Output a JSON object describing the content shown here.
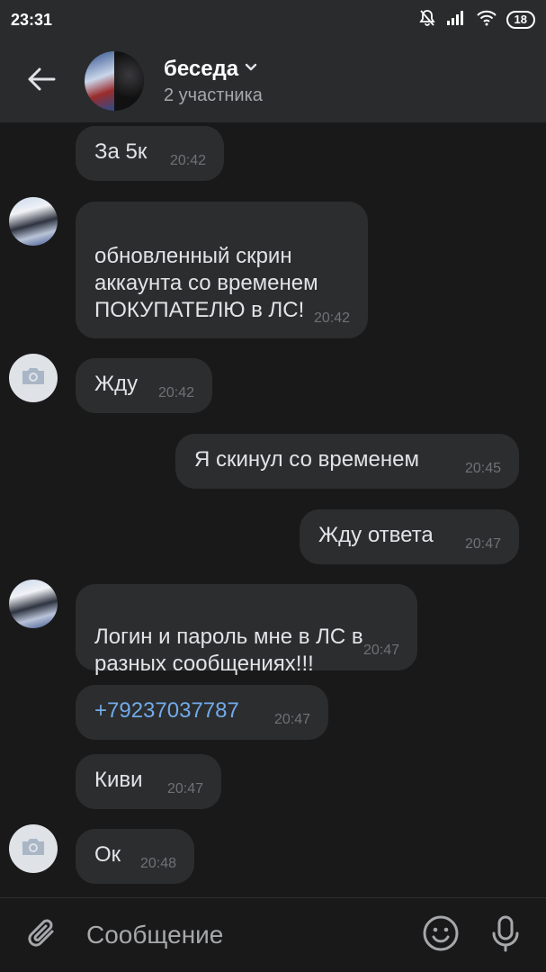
{
  "status_bar": {
    "time": "23:31",
    "battery": "18"
  },
  "header": {
    "title": "беседа",
    "subtitle": "2 участника"
  },
  "messages": [
    {
      "text": "За 5к",
      "time": "20:42"
    },
    {
      "text": "обновленный скрин\nаккаунта со временем\nПОКУПАТЕЛЮ в ЛС!",
      "time": "20:42"
    },
    {
      "text": "Жду",
      "time": "20:42"
    },
    {
      "text": "Я скинул со временем",
      "time": "20:45"
    },
    {
      "text": "Жду ответа",
      "time": "20:47"
    },
    {
      "text": "Логин и пароль мне в ЛС в\nразных сообщениях!!!",
      "time": "20:47"
    },
    {
      "text": "+79237037787",
      "time": "20:47"
    },
    {
      "text": "Киви",
      "time": "20:47"
    },
    {
      "text": "Ок",
      "time": "20:48"
    }
  ],
  "composer": {
    "placeholder": "Сообщение"
  },
  "icons": {
    "back": "arrow-left-icon",
    "dropdown": "chevron-down-icon",
    "attach": "paperclip-icon",
    "emoji": "smiley-icon",
    "mic": "microphone-icon",
    "camera": "camera-icon"
  },
  "colors": {
    "background": "#19191a",
    "header": "#2a2b2d",
    "bubble": "#2c2d2e",
    "link": "#71aaeb",
    "time": "#6f7175"
  }
}
